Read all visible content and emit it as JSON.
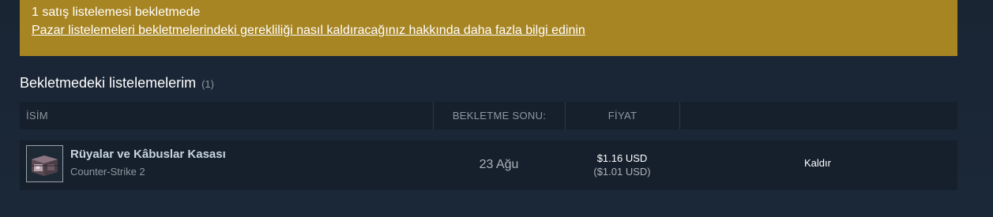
{
  "notice": {
    "title": "1 satış listelemesi bekletmede",
    "link": "Pazar listelemeleri bekletmelerindeki gerekliliği nasıl kaldıracağınız hakkında daha fazla bilgi edinin",
    "background_color": "#a88523"
  },
  "section": {
    "title": "Bekletmedeki listelemelerim",
    "count": "(1)"
  },
  "table": {
    "columns": {
      "name": "İSİM",
      "hold_end": "BEKLETME SONU:",
      "price": "FİYAT"
    },
    "rows": [
      {
        "item_name": "Rüyalar ve Kâbuslar Kasası",
        "game": "Counter-Strike 2",
        "icon": "case-icon",
        "hold_end": "23 Ağu",
        "price": "$1.16 USD",
        "price_net": "($1.01 USD)",
        "action": "Kaldır"
      }
    ]
  }
}
